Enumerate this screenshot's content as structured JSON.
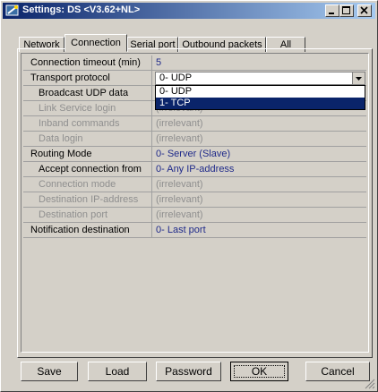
{
  "window": {
    "title": "Settings: DS <V3.62+NL>",
    "controls": [
      "minimize-icon",
      "maximize-icon",
      "close-icon"
    ]
  },
  "tabs": [
    {
      "label": "Network"
    },
    {
      "label": "Connection",
      "active": true
    },
    {
      "label": "Serial port"
    },
    {
      "label": "Outbound packets"
    },
    {
      "label": "All"
    }
  ],
  "rows": [
    {
      "name": "Connection timeout (min)",
      "value": "5"
    },
    {
      "name": "Transport protocol",
      "value": "0- UDP"
    },
    {
      "name": "Broadcast UDP data",
      "value": ""
    },
    {
      "name": "Link Service login",
      "value": "(irrelevant)"
    },
    {
      "name": "Inband commands",
      "value": "(irrelevant)"
    },
    {
      "name": "Data login",
      "value": "(irrelevant)"
    },
    {
      "name": "Routing Mode",
      "value": "0- Server (Slave)"
    },
    {
      "name": "Accept connection from",
      "value": "0- Any IP-address"
    },
    {
      "name": "Connection mode",
      "value": "(irrelevant)"
    },
    {
      "name": "Destination IP-address",
      "value": "(irrelevant)"
    },
    {
      "name": "Destination port",
      "value": "(irrelevant)"
    },
    {
      "name": "Notification destination",
      "value": "0- Last port"
    }
  ],
  "dropdown": {
    "options": [
      "0- UDP",
      "1- TCP"
    ],
    "highlighted": "1- TCP"
  },
  "buttons": {
    "save": "Save",
    "load": "Load",
    "password": "Password",
    "ok": "OK",
    "cancel": "Cancel"
  },
  "colors": {
    "title_start": "#0a246a",
    "title_end": "#a6caf0",
    "value_text": "#1f2a8a",
    "disabled_text": "#8f8f8f",
    "face": "#d4d0c8"
  }
}
